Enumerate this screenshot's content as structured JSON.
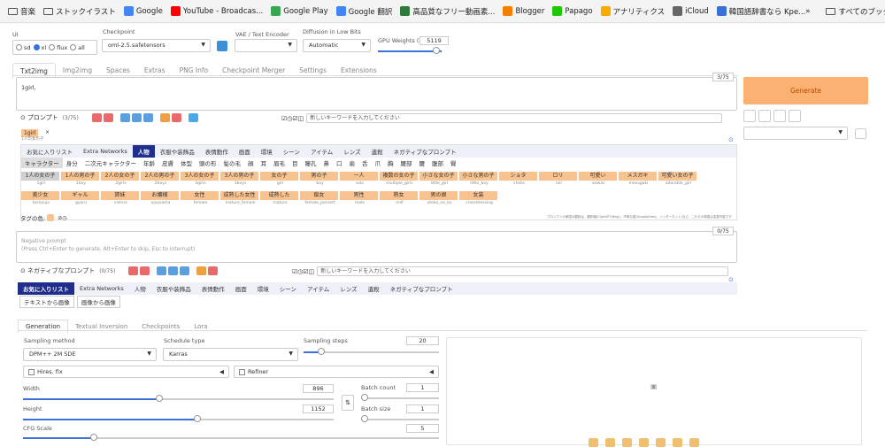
{
  "bookmarks": [
    "音楽",
    "ストックイラスト",
    "Google",
    "YouTube - Broadcas...",
    "Google Play",
    "Google 翻訳",
    "高品質なフリー動画素...",
    "Blogger",
    "Papago",
    "アナリティクス",
    "iCloud",
    "韓国語辞書なら Kpe...",
    "»",
    "すべてのブックマーク"
  ],
  "ui": {
    "label": "UI",
    "options": [
      "sd",
      "xl",
      "flux",
      "all"
    ]
  },
  "checkpoint": {
    "label": "Checkpoint",
    "value": "oml-2.5.safetensors"
  },
  "vae": {
    "label": "VAE / Text Encoder"
  },
  "diffusion": {
    "label": "Diffusion in Low Bits",
    "value": "Automatic"
  },
  "gpu": {
    "label": "GPU Weights (MB)",
    "value": "5119"
  },
  "tabs": [
    "Txt2img",
    "Img2img",
    "Spaces",
    "Extras",
    "PNG Info",
    "Checkpoint Merger",
    "Settings",
    "Extensions"
  ],
  "prompt": {
    "text": "1girl,",
    "count": "3/75",
    "label": "プロンプト",
    "sublabel": "(3/75)",
    "search_placeholder": "新しいキーワードを入力してください",
    "tag": "1girl",
    "tag_sub": "1人の女の子"
  },
  "generate": "Generate",
  "categories": [
    "お気に入りリスト",
    "Extra Networks",
    "人物",
    "衣服や装飾品",
    "表情動作",
    "画面",
    "環境",
    "シーン",
    "アイテム",
    "レンズ",
    "遺殺",
    "ネガティブなプロンプト"
  ],
  "subcategories": [
    "キャラクター",
    "身分",
    "二次元キャラクター",
    "年齢",
    "皮膚",
    "体型",
    "頭の形",
    "髪の毛",
    "顔",
    "耳",
    "眉毛",
    "目",
    "瞳孔",
    "鼻",
    "口",
    "歯",
    "舌",
    "爪",
    "胸",
    "腰部",
    "腰",
    "腹部",
    "臀"
  ],
  "words": [
    [
      "1人の女の子",
      "1girl"
    ],
    [
      "1人の男の子",
      "1boy"
    ],
    [
      "2人の女の子",
      "2girls"
    ],
    [
      "2人の男の子",
      "2boys"
    ],
    [
      "3人の女の子",
      "3girls"
    ],
    [
      "3人の男の子",
      "3boys"
    ],
    [
      "女の子",
      "girl"
    ],
    [
      "男の子",
      "boy"
    ],
    [
      "一人",
      "solo"
    ],
    [
      "複数の女の子",
      "multiple_girls"
    ],
    [
      "小さな女の子",
      "little_girl"
    ],
    [
      "小さな男の子",
      "little_boy"
    ],
    [
      "ショタ",
      "shota"
    ],
    [
      "ロリ",
      "loli"
    ],
    [
      "可愛い",
      "kawaii"
    ],
    [
      "メスガキ",
      "mesugaki"
    ],
    [
      "可愛い女の子",
      "adorable_girl"
    ],
    [
      "美少女",
      "bishoujo"
    ],
    [
      "ギャル",
      "gyaru"
    ],
    [
      "姉妹",
      "sisters"
    ],
    [
      "お嬢様",
      "ojousama"
    ],
    [
      "女性",
      "female"
    ],
    [
      "成熟した女性",
      "mature_female"
    ],
    [
      "成熟した",
      "mature"
    ],
    [
      "痴女",
      "female_pervert"
    ],
    [
      "男性",
      "male"
    ],
    [
      "熟女",
      "milf"
    ],
    [
      "男の娘",
      "otoko_no_ko"
    ],
    [
      "女装",
      "crossdressing"
    ]
  ],
  "tag_color_label": "タグの色:",
  "footnote": "プロンプトの単語の翻訳は、翻訳機(ChatGPT/Bing)、不明な語(Google(free)、インターネット)など。これらの単語は変更可能です",
  "negative": {
    "placeholder_line1": "Negative prompt",
    "placeholder_line2": "(Press Ctrl+Enter to generate, Alt+Enter to skip, Esc to interrupt)",
    "count": "0/75",
    "label": "ネガティブなプロンプト",
    "sublabel": "(0/75)",
    "search_placeholder": "新しいキーワードを入力してください",
    "sub1": "テキストから画像",
    "sub2": "画像から画像"
  },
  "gen_tabs": [
    "Generation",
    "Textual Inversion",
    "Checkpoints",
    "Lora"
  ],
  "sampling_method": {
    "label": "Sampling method",
    "value": "DPM++ 2M SDE"
  },
  "schedule": {
    "label": "Schedule type",
    "value": "Karras"
  },
  "steps": {
    "label": "Sampling steps",
    "value": "20",
    "fraction": 0.13
  },
  "hires": "Hires. fix",
  "refiner": "Refiner",
  "width": {
    "label": "Width",
    "value": "896",
    "fraction": 0.44
  },
  "height": {
    "label": "Height",
    "value": "1152",
    "fraction": 0.56
  },
  "batch_count": {
    "label": "Batch count",
    "value": "1"
  },
  "batch_size": {
    "label": "Batch size",
    "value": "1"
  },
  "cfg": {
    "label": "CFG Scale",
    "value": "5",
    "fraction": 0.17
  },
  "colors": {
    "generate": "#fbb171",
    "category_active": "#1f2d8c",
    "word": "#f8c38f"
  }
}
